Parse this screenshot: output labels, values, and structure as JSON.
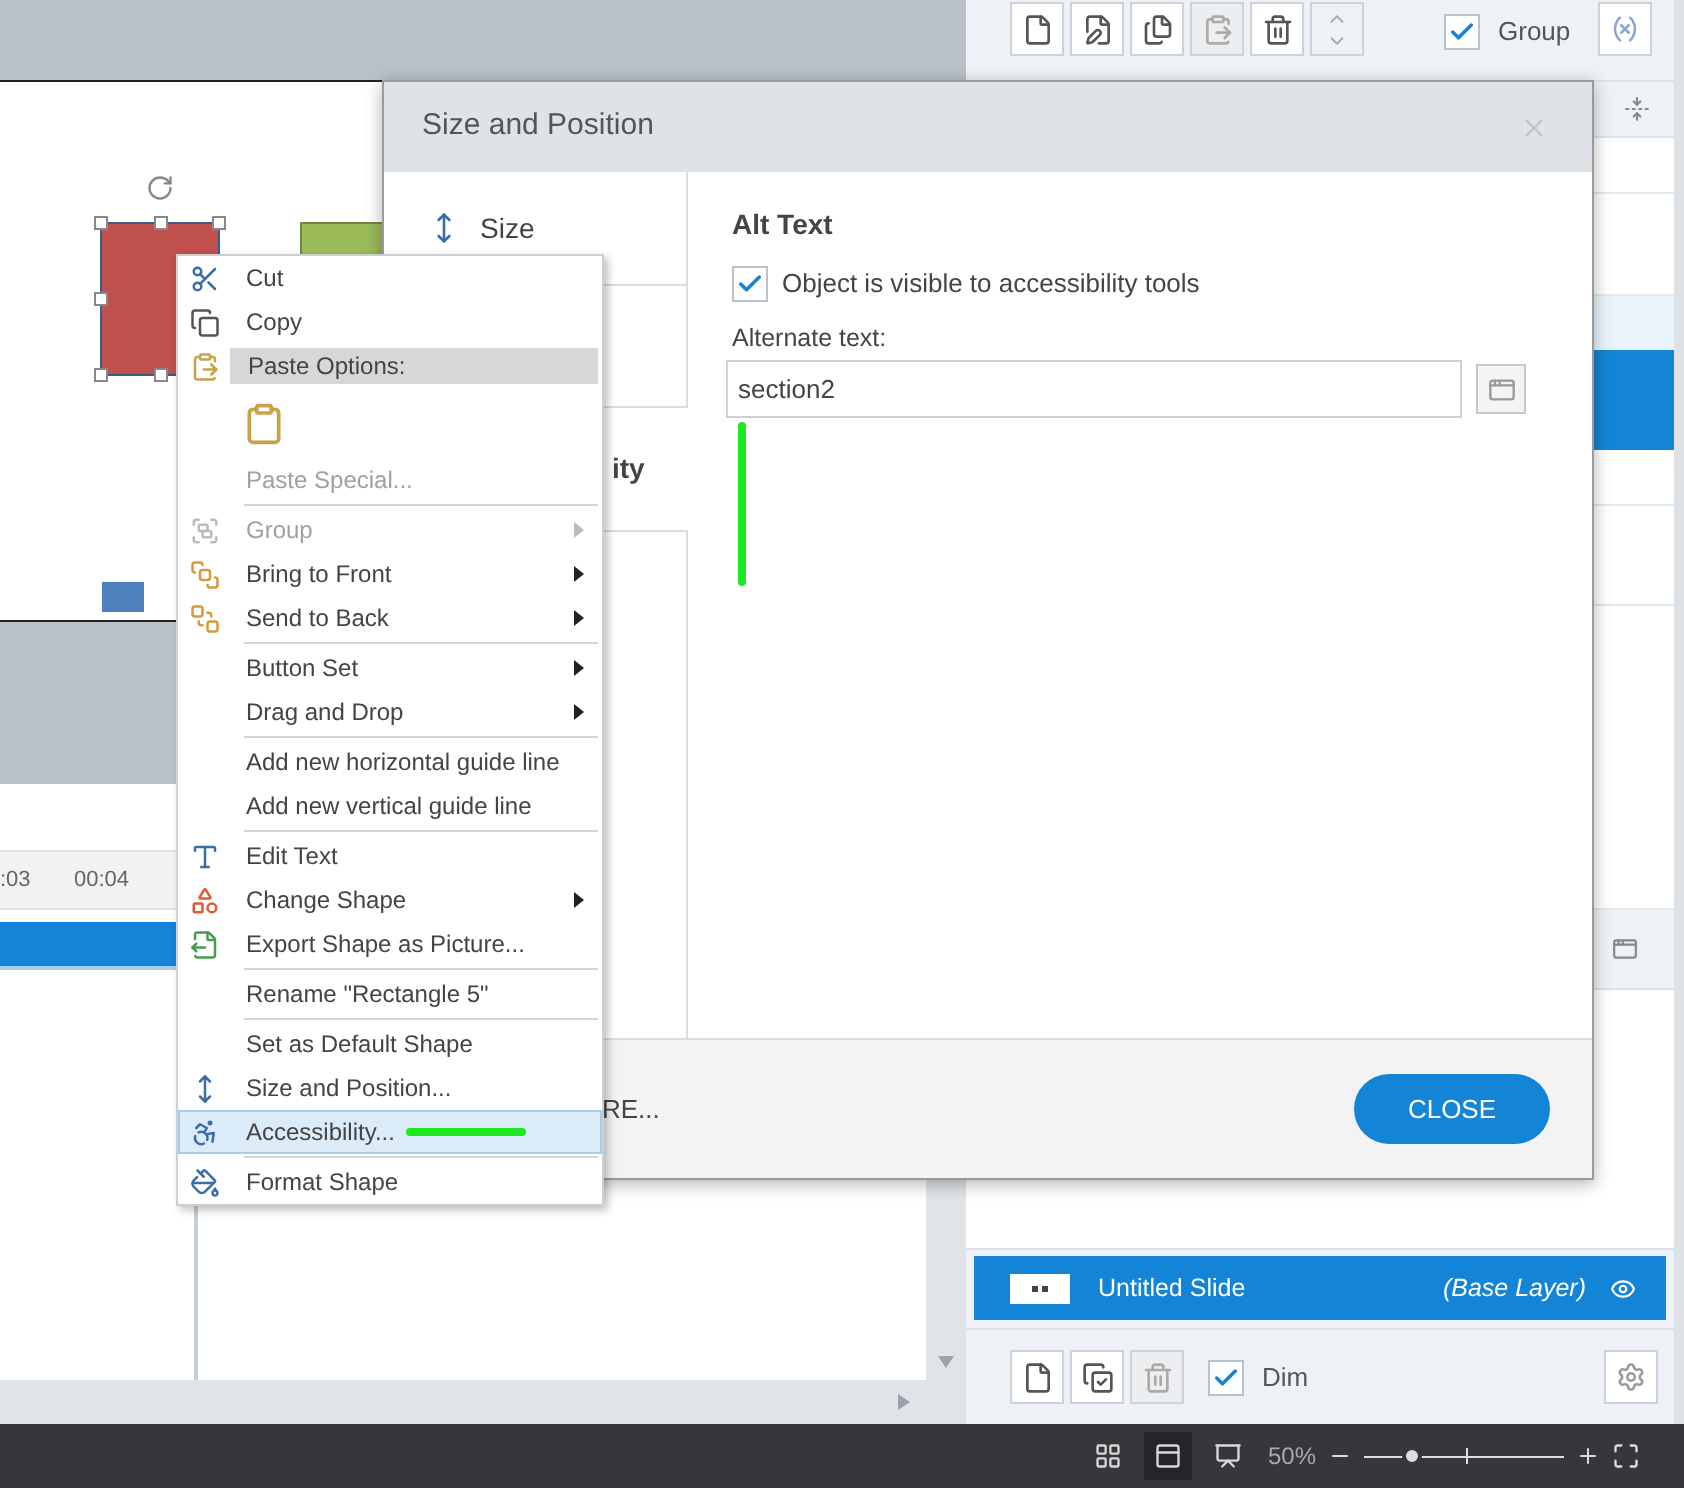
{
  "top_toolbar": {
    "buttons": [
      {
        "disabled": false
      },
      {
        "disabled": false
      },
      {
        "disabled": false
      },
      {
        "disabled": true
      },
      {
        "disabled": false
      }
    ],
    "group_checkbox": {
      "label": "Group",
      "checked": true
    }
  },
  "timeline": {
    "ticks": [
      ":03",
      "00:04"
    ]
  },
  "dialog": {
    "title": "Size and Position",
    "nav": [
      {
        "label": "Size",
        "selected": false
      }
    ],
    "nav_heading_partial": "ity",
    "footer_partial": "RE...",
    "section_title": "Alt Text",
    "visible_checkbox": {
      "label": "Object is visible to accessibility tools",
      "checked": true
    },
    "alt_text": {
      "label": "Alternate text:",
      "value": "section2"
    },
    "close_button": "CLOSE"
  },
  "context_menu": {
    "items": [
      {
        "kind": "item",
        "label": "Cut",
        "disabled": false,
        "submenu": false,
        "selected": false
      },
      {
        "kind": "item",
        "label": "Copy",
        "disabled": false,
        "submenu": false,
        "selected": false
      },
      {
        "kind": "header",
        "label": "Paste Options:"
      },
      {
        "kind": "paste-option"
      },
      {
        "kind": "item",
        "label": "Paste Special...",
        "disabled": true,
        "submenu": false,
        "selected": false
      },
      {
        "kind": "separator"
      },
      {
        "kind": "item",
        "label": "Group",
        "disabled": true,
        "submenu": true,
        "selected": false
      },
      {
        "kind": "item",
        "label": "Bring to Front",
        "disabled": false,
        "submenu": true,
        "selected": false
      },
      {
        "kind": "item",
        "label": "Send to Back",
        "disabled": false,
        "submenu": true,
        "selected": false
      },
      {
        "kind": "separator"
      },
      {
        "kind": "item",
        "label": "Button Set",
        "disabled": false,
        "submenu": true,
        "selected": false
      },
      {
        "kind": "item",
        "label": "Drag and Drop",
        "disabled": false,
        "submenu": true,
        "selected": false
      },
      {
        "kind": "separator"
      },
      {
        "kind": "item",
        "label": "Add new horizontal guide line",
        "disabled": false,
        "submenu": false,
        "selected": false
      },
      {
        "kind": "item",
        "label": "Add new vertical guide line",
        "disabled": false,
        "submenu": false,
        "selected": false
      },
      {
        "kind": "separator"
      },
      {
        "kind": "item",
        "label": "Edit Text",
        "disabled": false,
        "submenu": false,
        "selected": false
      },
      {
        "kind": "item",
        "label": "Change Shape",
        "disabled": false,
        "submenu": true,
        "selected": false
      },
      {
        "kind": "item",
        "label": "Export Shape as Picture...",
        "disabled": false,
        "submenu": false,
        "selected": false
      },
      {
        "kind": "separator"
      },
      {
        "kind": "item",
        "label": "Rename \"Rectangle 5\"",
        "disabled": false,
        "submenu": false,
        "selected": false
      },
      {
        "kind": "separator"
      },
      {
        "kind": "item",
        "label": "Set as Default Shape",
        "disabled": false,
        "submenu": false,
        "selected": false
      },
      {
        "kind": "item",
        "label": "Size and Position...",
        "disabled": false,
        "submenu": false,
        "selected": false
      },
      {
        "kind": "item",
        "label": "Accessibility...",
        "disabled": false,
        "submenu": false,
        "selected": true
      },
      {
        "kind": "separator"
      },
      {
        "kind": "item",
        "label": "Format Shape",
        "disabled": false,
        "submenu": false,
        "selected": false
      }
    ]
  },
  "layers": [
    {
      "name": "Untitled Slide",
      "tag": "(Base Layer)",
      "selected": true,
      "visible": true
    }
  ],
  "layer_toolbar": {
    "buttons": [
      {
        "disabled": false
      },
      {
        "disabled": false
      },
      {
        "disabled": true
      }
    ],
    "dim_checkbox": {
      "label": "Dim",
      "checked": true
    }
  },
  "status_bar": {
    "views": [
      {
        "selected": false
      },
      {
        "selected": true
      },
      {
        "selected": false
      }
    ],
    "zoom": "50%",
    "zoom_slider": {
      "level": 0.24
    }
  }
}
